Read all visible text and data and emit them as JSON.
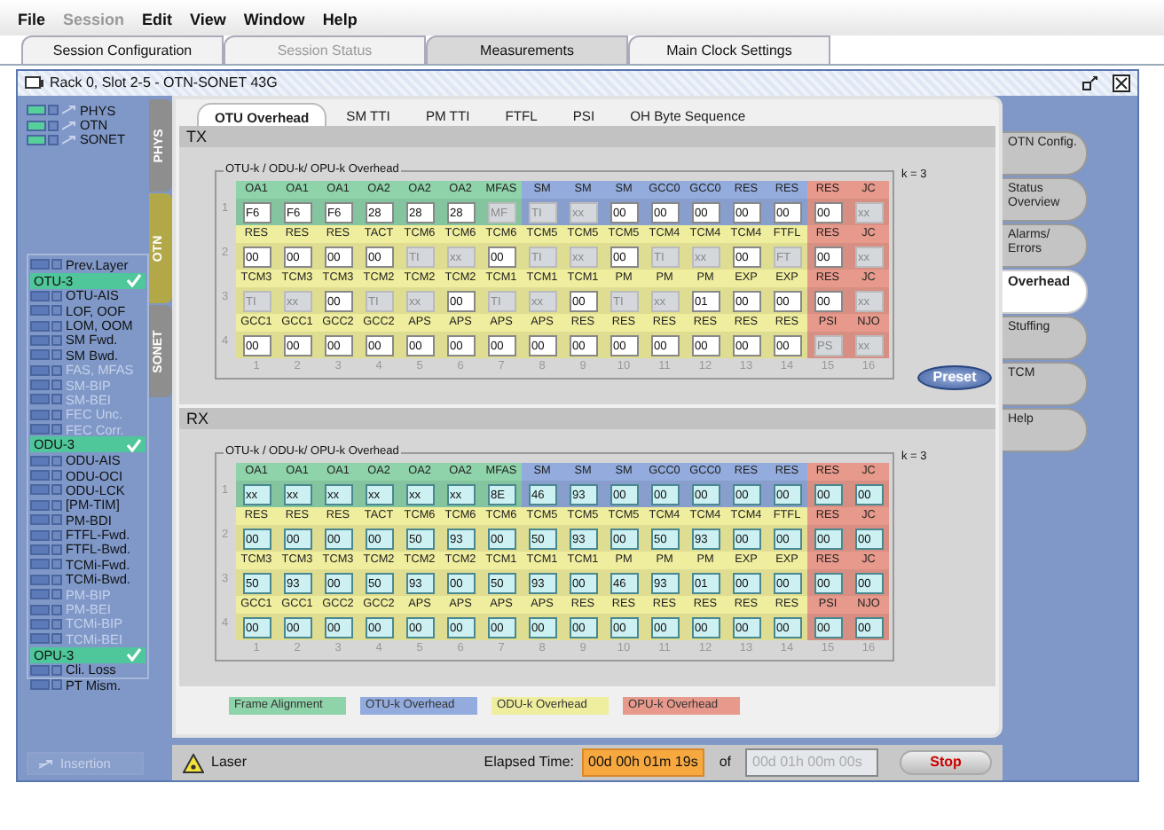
{
  "menu": [
    {
      "label": "File",
      "disabled": false
    },
    {
      "label": "Session",
      "disabled": true
    },
    {
      "label": "Edit",
      "disabled": false
    },
    {
      "label": "View",
      "disabled": false
    },
    {
      "label": "Window",
      "disabled": false
    },
    {
      "label": "Help",
      "disabled": false
    }
  ],
  "session_tabs": [
    {
      "label": "Session Configuration",
      "selected": false,
      "disabled": false
    },
    {
      "label": "Session Status",
      "selected": false,
      "disabled": true
    },
    {
      "label": "Measurements",
      "selected": true,
      "disabled": false
    },
    {
      "label": "Main Clock Settings",
      "selected": false,
      "disabled": false
    }
  ],
  "window": {
    "title": "Rack 0, Slot 2-5 - OTN-SONET 43G"
  },
  "layers": [
    {
      "label": "PHYS",
      "on": true,
      "checked": false
    },
    {
      "label": "OTN",
      "on": true,
      "checked": false
    },
    {
      "label": "SONET",
      "on": true,
      "checked": false
    }
  ],
  "layer_tabs": [
    {
      "label": "PHYS",
      "selected": false
    },
    {
      "label": "OTN",
      "selected": true
    },
    {
      "label": "SONET",
      "selected": false
    }
  ],
  "alarms": [
    {
      "kind": "alarm",
      "label": "Prev.Layer",
      "disabled": false
    },
    {
      "kind": "group",
      "label": "OTU-3",
      "ok": true
    },
    {
      "kind": "alarm",
      "label": "OTU-AIS",
      "disabled": false
    },
    {
      "kind": "alarm",
      "label": "LOF, OOF",
      "disabled": false
    },
    {
      "kind": "alarm",
      "label": "LOM, OOM",
      "disabled": false
    },
    {
      "kind": "alarm",
      "label": "SM Fwd.",
      "disabled": false
    },
    {
      "kind": "alarm",
      "label": "SM Bwd.",
      "disabled": false
    },
    {
      "kind": "alarm",
      "label": "FAS, MFAS",
      "disabled": true
    },
    {
      "kind": "alarm",
      "label": "SM-BIP",
      "disabled": true
    },
    {
      "kind": "alarm",
      "label": "SM-BEI",
      "disabled": true
    },
    {
      "kind": "alarm",
      "label": "FEC Unc.",
      "disabled": true
    },
    {
      "kind": "alarm",
      "label": "FEC Corr.",
      "disabled": true
    },
    {
      "kind": "group",
      "label": "ODU-3",
      "ok": true
    },
    {
      "kind": "alarm",
      "label": "ODU-AIS",
      "disabled": false
    },
    {
      "kind": "alarm",
      "label": "ODU-OCI",
      "disabled": false
    },
    {
      "kind": "alarm",
      "label": "ODU-LCK",
      "disabled": false
    },
    {
      "kind": "alarm",
      "label": "[PM-TIM]",
      "disabled": false
    },
    {
      "kind": "alarm",
      "label": "PM-BDI",
      "disabled": false
    },
    {
      "kind": "alarm",
      "label": "FTFL-Fwd.",
      "disabled": false
    },
    {
      "kind": "alarm",
      "label": "FTFL-Bwd.",
      "disabled": false
    },
    {
      "kind": "alarm",
      "label": "TCMi-Fwd.",
      "disabled": false
    },
    {
      "kind": "alarm",
      "label": "TCMi-Bwd.",
      "disabled": false
    },
    {
      "kind": "alarm",
      "label": "PM-BIP",
      "disabled": true
    },
    {
      "kind": "alarm",
      "label": "PM-BEI",
      "disabled": true
    },
    {
      "kind": "alarm",
      "label": "TCMi-BIP",
      "disabled": true
    },
    {
      "kind": "alarm",
      "label": "TCMi-BEI",
      "disabled": true
    },
    {
      "kind": "group",
      "label": "OPU-3",
      "ok": true
    },
    {
      "kind": "alarm",
      "label": "Cli. Loss",
      "disabled": false
    },
    {
      "kind": "alarm",
      "label": "PT Mism.",
      "disabled": false
    }
  ],
  "insertion": {
    "label": "Insertion",
    "disabled": true
  },
  "overhead_tabs": [
    {
      "label": "OTU Overhead",
      "selected": true
    },
    {
      "label": "SM TTI",
      "selected": false
    },
    {
      "label": "PM TTI",
      "selected": false
    },
    {
      "label": "FTFL",
      "selected": false
    },
    {
      "label": "PSI",
      "selected": false
    },
    {
      "label": "OH Byte Sequence",
      "selected": false
    }
  ],
  "sections": [
    {
      "title": "TX",
      "kind": "input",
      "legend": "OTU-k / ODU-k/ OPU-k Overhead",
      "k_label": "k = 3",
      "preset": "Preset",
      "columns": [
        "1",
        "2",
        "3",
        "4",
        "5",
        "6",
        "7",
        "8",
        "9",
        "10",
        "11",
        "12",
        "13",
        "14",
        "15",
        "16"
      ],
      "rows": [
        {
          "number": "1",
          "segments": [
            {
              "kind": "fa",
              "cells": [
                {
                  "label": "OA1",
                  "value": "F6",
                  "disabled": false
                },
                {
                  "label": "OA1",
                  "value": "F6",
                  "disabled": false
                },
                {
                  "label": "OA1",
                  "value": "F6",
                  "disabled": false
                },
                {
                  "label": "OA2",
                  "value": "28",
                  "disabled": false
                },
                {
                  "label": "OA2",
                  "value": "28",
                  "disabled": false
                },
                {
                  "label": "OA2",
                  "value": "28",
                  "disabled": false
                },
                {
                  "label": "MFAS",
                  "value": "MF",
                  "disabled": true
                }
              ]
            },
            {
              "kind": "otu",
              "cells": [
                {
                  "label": "SM",
                  "value": "TI",
                  "disabled": true
                },
                {
                  "label": "SM",
                  "value": "xx",
                  "disabled": true
                },
                {
                  "label": "SM",
                  "value": "00",
                  "disabled": false
                },
                {
                  "label": "GCC0",
                  "value": "00",
                  "disabled": false
                },
                {
                  "label": "GCC0",
                  "value": "00",
                  "disabled": false
                },
                {
                  "label": "RES",
                  "value": "00",
                  "disabled": false
                },
                {
                  "label": "RES",
                  "value": "00",
                  "disabled": false
                }
              ]
            },
            {
              "kind": "opu",
              "cells": [
                {
                  "label": "RES",
                  "value": "00",
                  "disabled": false
                },
                {
                  "label": "JC",
                  "value": "xx",
                  "disabled": true
                }
              ]
            }
          ]
        },
        {
          "number": "2",
          "segments": [
            {
              "kind": "odu",
              "cells": [
                {
                  "label": "RES",
                  "value": "00",
                  "disabled": false
                },
                {
                  "label": "RES",
                  "value": "00",
                  "disabled": false
                },
                {
                  "label": "RES",
                  "value": "00",
                  "disabled": false
                },
                {
                  "label": "TACT",
                  "value": "00",
                  "disabled": false
                },
                {
                  "label": "TCM6",
                  "value": "TI",
                  "disabled": true
                },
                {
                  "label": "TCM6",
                  "value": "xx",
                  "disabled": true
                },
                {
                  "label": "TCM6",
                  "value": "00",
                  "disabled": false
                },
                {
                  "label": "TCM5",
                  "value": "TI",
                  "disabled": true
                },
                {
                  "label": "TCM5",
                  "value": "xx",
                  "disabled": true
                },
                {
                  "label": "TCM5",
                  "value": "00",
                  "disabled": false
                },
                {
                  "label": "TCM4",
                  "value": "TI",
                  "disabled": true
                },
                {
                  "label": "TCM4",
                  "value": "xx",
                  "disabled": true
                },
                {
                  "label": "TCM4",
                  "value": "00",
                  "disabled": false
                },
                {
                  "label": "FTFL",
                  "value": "FT",
                  "disabled": true
                }
              ]
            },
            {
              "kind": "opu",
              "cells": [
                {
                  "label": "RES",
                  "value": "00",
                  "disabled": false
                },
                {
                  "label": "JC",
                  "value": "xx",
                  "disabled": true
                }
              ]
            }
          ]
        },
        {
          "number": "3",
          "segments": [
            {
              "kind": "odu",
              "cells": [
                {
                  "label": "TCM3",
                  "value": "TI",
                  "disabled": true
                },
                {
                  "label": "TCM3",
                  "value": "xx",
                  "disabled": true
                },
                {
                  "label": "TCM3",
                  "value": "00",
                  "disabled": false
                },
                {
                  "label": "TCM2",
                  "value": "TI",
                  "disabled": true
                },
                {
                  "label": "TCM2",
                  "value": "xx",
                  "disabled": true
                },
                {
                  "label": "TCM2",
                  "value": "00",
                  "disabled": false
                },
                {
                  "label": "TCM1",
                  "value": "TI",
                  "disabled": true
                },
                {
                  "label": "TCM1",
                  "value": "xx",
                  "disabled": true
                },
                {
                  "label": "TCM1",
                  "value": "00",
                  "disabled": false
                },
                {
                  "label": "PM",
                  "value": "TI",
                  "disabled": true
                },
                {
                  "label": "PM",
                  "value": "xx",
                  "disabled": true
                },
                {
                  "label": "PM",
                  "value": "01",
                  "disabled": false
                },
                {
                  "label": "EXP",
                  "value": "00",
                  "disabled": false
                },
                {
                  "label": "EXP",
                  "value": "00",
                  "disabled": false
                }
              ]
            },
            {
              "kind": "opu",
              "cells": [
                {
                  "label": "RES",
                  "value": "00",
                  "disabled": false
                },
                {
                  "label": "JC",
                  "value": "xx",
                  "disabled": true
                }
              ]
            }
          ]
        },
        {
          "number": "4",
          "segments": [
            {
              "kind": "odu",
              "cells": [
                {
                  "label": "GCC1",
                  "value": "00",
                  "disabled": false
                },
                {
                  "label": "GCC1",
                  "value": "00",
                  "disabled": false
                },
                {
                  "label": "GCC2",
                  "value": "00",
                  "disabled": false
                },
                {
                  "label": "GCC2",
                  "value": "00",
                  "disabled": false
                },
                {
                  "label": "APS",
                  "value": "00",
                  "disabled": false
                },
                {
                  "label": "APS",
                  "value": "00",
                  "disabled": false
                },
                {
                  "label": "APS",
                  "value": "00",
                  "disabled": false
                },
                {
                  "label": "APS",
                  "value": "00",
                  "disabled": false
                },
                {
                  "label": "RES",
                  "value": "00",
                  "disabled": false
                },
                {
                  "label": "RES",
                  "value": "00",
                  "disabled": false
                },
                {
                  "label": "RES",
                  "value": "00",
                  "disabled": false
                },
                {
                  "label": "RES",
                  "value": "00",
                  "disabled": false
                },
                {
                  "label": "RES",
                  "value": "00",
                  "disabled": false
                },
                {
                  "label": "RES",
                  "value": "00",
                  "disabled": false
                }
              ]
            },
            {
              "kind": "opu",
              "cells": [
                {
                  "label": "PSI",
                  "value": "PS",
                  "disabled": true
                },
                {
                  "label": "NJO",
                  "value": "xx",
                  "disabled": true
                }
              ]
            }
          ]
        }
      ]
    },
    {
      "title": "RX",
      "kind": "display",
      "legend": "OTU-k / ODU-k/ OPU-k Overhead",
      "k_label": "k = 3",
      "columns": [
        "1",
        "2",
        "3",
        "4",
        "5",
        "6",
        "7",
        "8",
        "9",
        "10",
        "11",
        "12",
        "13",
        "14",
        "15",
        "16"
      ],
      "rows": [
        {
          "number": "1",
          "segments": [
            {
              "kind": "fa",
              "cells": [
                {
                  "label": "OA1",
                  "value": "xx",
                  "disabled": false
                },
                {
                  "label": "OA1",
                  "value": "xx",
                  "disabled": false
                },
                {
                  "label": "OA1",
                  "value": "xx",
                  "disabled": false
                },
                {
                  "label": "OA2",
                  "value": "xx",
                  "disabled": false
                },
                {
                  "label": "OA2",
                  "value": "xx",
                  "disabled": false
                },
                {
                  "label": "OA2",
                  "value": "xx",
                  "disabled": false
                },
                {
                  "label": "MFAS",
                  "value": "8E",
                  "disabled": false
                }
              ]
            },
            {
              "kind": "otu",
              "cells": [
                {
                  "label": "SM",
                  "value": "46",
                  "disabled": false
                },
                {
                  "label": "SM",
                  "value": "93",
                  "disabled": false
                },
                {
                  "label": "SM",
                  "value": "00",
                  "disabled": false
                },
                {
                  "label": "GCC0",
                  "value": "00",
                  "disabled": false
                },
                {
                  "label": "GCC0",
                  "value": "00",
                  "disabled": false
                },
                {
                  "label": "RES",
                  "value": "00",
                  "disabled": false
                },
                {
                  "label": "RES",
                  "value": "00",
                  "disabled": false
                }
              ]
            },
            {
              "kind": "opu",
              "cells": [
                {
                  "label": "RES",
                  "value": "00",
                  "disabled": false
                },
                {
                  "label": "JC",
                  "value": "00",
                  "disabled": false
                }
              ]
            }
          ]
        },
        {
          "number": "2",
          "segments": [
            {
              "kind": "odu",
              "cells": [
                {
                  "label": "RES",
                  "value": "00",
                  "disabled": false
                },
                {
                  "label": "RES",
                  "value": "00",
                  "disabled": false
                },
                {
                  "label": "RES",
                  "value": "00",
                  "disabled": false
                },
                {
                  "label": "TACT",
                  "value": "00",
                  "disabled": false
                },
                {
                  "label": "TCM6",
                  "value": "50",
                  "disabled": false
                },
                {
                  "label": "TCM6",
                  "value": "93",
                  "disabled": false
                },
                {
                  "label": "TCM6",
                  "value": "00",
                  "disabled": false
                },
                {
                  "label": "TCM5",
                  "value": "50",
                  "disabled": false
                },
                {
                  "label": "TCM5",
                  "value": "93",
                  "disabled": false
                },
                {
                  "label": "TCM5",
                  "value": "00",
                  "disabled": false
                },
                {
                  "label": "TCM4",
                  "value": "50",
                  "disabled": false
                },
                {
                  "label": "TCM4",
                  "value": "93",
                  "disabled": false
                },
                {
                  "label": "TCM4",
                  "value": "00",
                  "disabled": false
                },
                {
                  "label": "FTFL",
                  "value": "00",
                  "disabled": false
                }
              ]
            },
            {
              "kind": "opu",
              "cells": [
                {
                  "label": "RES",
                  "value": "00",
                  "disabled": false
                },
                {
                  "label": "JC",
                  "value": "00",
                  "disabled": false
                }
              ]
            }
          ]
        },
        {
          "number": "3",
          "segments": [
            {
              "kind": "odu",
              "cells": [
                {
                  "label": "TCM3",
                  "value": "50",
                  "disabled": false
                },
                {
                  "label": "TCM3",
                  "value": "93",
                  "disabled": false
                },
                {
                  "label": "TCM3",
                  "value": "00",
                  "disabled": false
                },
                {
                  "label": "TCM2",
                  "value": "50",
                  "disabled": false
                },
                {
                  "label": "TCM2",
                  "value": "93",
                  "disabled": false
                },
                {
                  "label": "TCM2",
                  "value": "00",
                  "disabled": false
                },
                {
                  "label": "TCM1",
                  "value": "50",
                  "disabled": false
                },
                {
                  "label": "TCM1",
                  "value": "93",
                  "disabled": false
                },
                {
                  "label": "TCM1",
                  "value": "00",
                  "disabled": false
                },
                {
                  "label": "PM",
                  "value": "46",
                  "disabled": false
                },
                {
                  "label": "PM",
                  "value": "93",
                  "disabled": false
                },
                {
                  "label": "PM",
                  "value": "01",
                  "disabled": false
                },
                {
                  "label": "EXP",
                  "value": "00",
                  "disabled": false
                },
                {
                  "label": "EXP",
                  "value": "00",
                  "disabled": false
                }
              ]
            },
            {
              "kind": "opu",
              "cells": [
                {
                  "label": "RES",
                  "value": "00",
                  "disabled": false
                },
                {
                  "label": "JC",
                  "value": "00",
                  "disabled": false
                }
              ]
            }
          ]
        },
        {
          "number": "4",
          "segments": [
            {
              "kind": "odu",
              "cells": [
                {
                  "label": "GCC1",
                  "value": "00",
                  "disabled": false
                },
                {
                  "label": "GCC1",
                  "value": "00",
                  "disabled": false
                },
                {
                  "label": "GCC2",
                  "value": "00",
                  "disabled": false
                },
                {
                  "label": "GCC2",
                  "value": "00",
                  "disabled": false
                },
                {
                  "label": "APS",
                  "value": "00",
                  "disabled": false
                },
                {
                  "label": "APS",
                  "value": "00",
                  "disabled": false
                },
                {
                  "label": "APS",
                  "value": "00",
                  "disabled": false
                },
                {
                  "label": "APS",
                  "value": "00",
                  "disabled": false
                },
                {
                  "label": "RES",
                  "value": "00",
                  "disabled": false
                },
                {
                  "label": "RES",
                  "value": "00",
                  "disabled": false
                },
                {
                  "label": "RES",
                  "value": "00",
                  "disabled": false
                },
                {
                  "label": "RES",
                  "value": "00",
                  "disabled": false
                },
                {
                  "label": "RES",
                  "value": "00",
                  "disabled": false
                },
                {
                  "label": "RES",
                  "value": "00",
                  "disabled": false
                }
              ]
            },
            {
              "kind": "opu",
              "cells": [
                {
                  "label": "PSI",
                  "value": "00",
                  "disabled": false
                },
                {
                  "label": "NJO",
                  "value": "00",
                  "disabled": false
                }
              ]
            }
          ]
        }
      ]
    }
  ],
  "legend": [
    {
      "kind": "fa",
      "label": "Frame Alignment"
    },
    {
      "kind": "otu",
      "label": "OTU-k Overhead"
    },
    {
      "kind": "odu",
      "label": "ODU-k Overhead"
    },
    {
      "kind": "opu",
      "label": "OPU-k Overhead"
    }
  ],
  "side_tabs": [
    {
      "label": "OTN Config.",
      "selected": false
    },
    {
      "label": "Status Overview",
      "selected": false
    },
    {
      "label": "Alarms/ Errors",
      "selected": false
    },
    {
      "label": "Overhead",
      "selected": true
    },
    {
      "label": "Stuffing",
      "selected": false
    },
    {
      "label": "TCM",
      "selected": false
    },
    {
      "label": "Help",
      "selected": false
    }
  ],
  "status": {
    "laser": "Laser",
    "elapsed_label": "Elapsed Time:",
    "elapsed": "00d 00h 01m 19s",
    "of": "of",
    "duration": "00d 01h 00m 00s",
    "stop": "Stop"
  }
}
